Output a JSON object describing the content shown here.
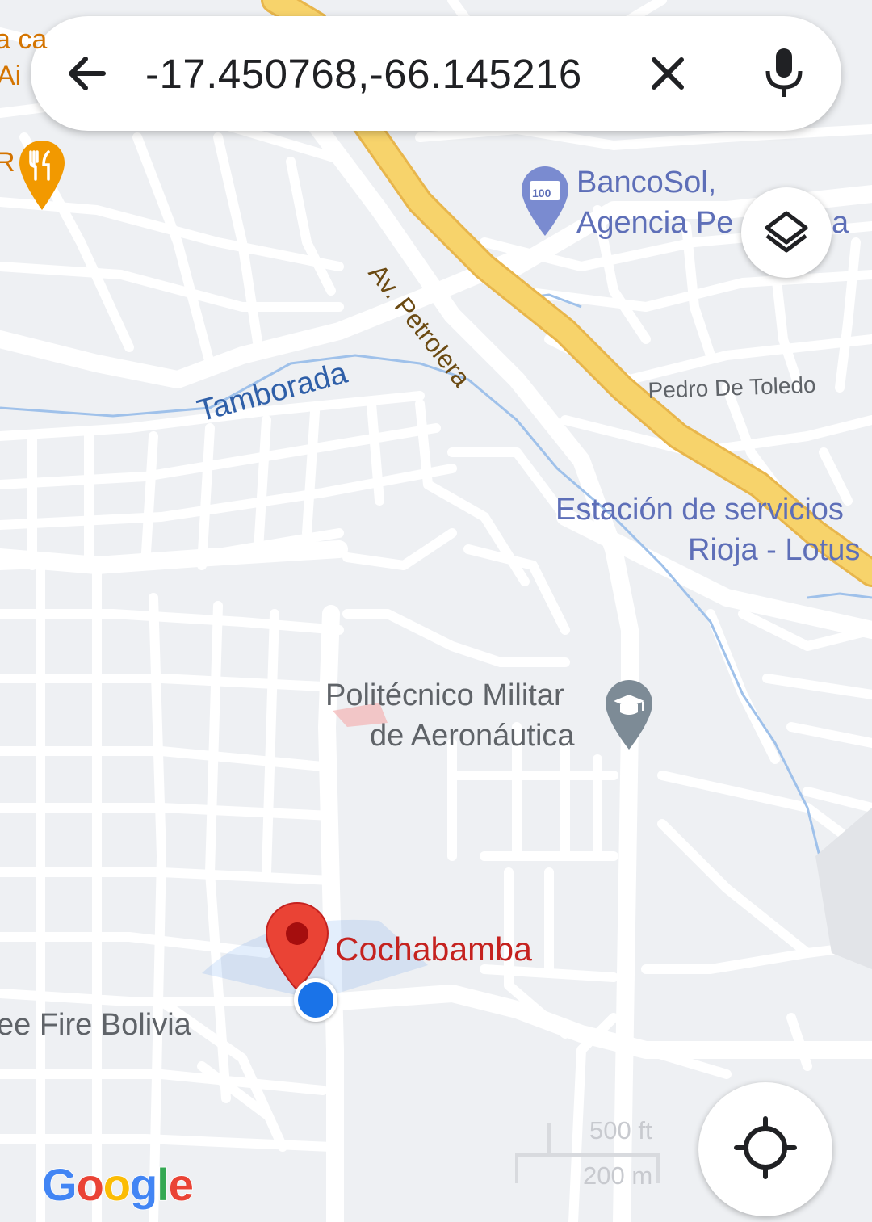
{
  "search": {
    "query": "-17.450768,-66.145216"
  },
  "icons": {
    "back": "arrow-back-icon",
    "clear": "close-icon",
    "voice": "microphone-icon",
    "layers": "layers-icon",
    "locate": "my-location-icon"
  },
  "places": {
    "bancosol_line1": "BancoSol,",
    "bancosol_line2": "Agencia Pe",
    "bancosol_tail": "a",
    "bancosol_badge": "100",
    "estacion_line1": "Estación de servicios",
    "estacion_line2": "Rioja - Lotus",
    "politecnico_line1": "Politécnico Militar",
    "politecnico_line2": "de Aeronáutica",
    "cochabamba": "Cochabamba",
    "fire_bolivia": "ee Fire Bolivia",
    "partial_top_1": "a ca",
    "partial_top_2": "Ai",
    "partial_top_3": "R"
  },
  "streets": {
    "petrolera": "Av. Petrolera",
    "tamborada": "Tamborada",
    "pedro_de_toledo": "Pedro De Toledo"
  },
  "scale": {
    "imperial": "500 ft",
    "metric": "200 m"
  },
  "branding": {
    "logo": "Google"
  },
  "colors": {
    "map_background": "#eef0f3",
    "road": "#ffffff",
    "highway": "#f7d36b",
    "highway_casing": "#e8b64c",
    "river": "#9fc1ea",
    "poi_blue": "#5e6fb8",
    "pin_red": "#ea4335",
    "user_blue": "#1a73e8"
  }
}
